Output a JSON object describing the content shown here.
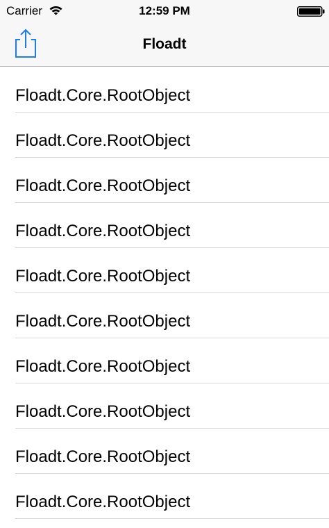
{
  "status_bar": {
    "carrier": "Carrier",
    "time": "12:59 PM",
    "wifi_icon": "wifi-icon",
    "battery_icon": "battery-full-icon"
  },
  "nav_bar": {
    "title": "Floadt",
    "share_icon": "share-icon",
    "accent_color": "#1a7cf9"
  },
  "list": {
    "items": [
      {
        "label": "Floadt.Core.RootObject"
      },
      {
        "label": "Floadt.Core.RootObject"
      },
      {
        "label": "Floadt.Core.RootObject"
      },
      {
        "label": "Floadt.Core.RootObject"
      },
      {
        "label": "Floadt.Core.RootObject"
      },
      {
        "label": "Floadt.Core.RootObject"
      },
      {
        "label": "Floadt.Core.RootObject"
      },
      {
        "label": "Floadt.Core.RootObject"
      },
      {
        "label": "Floadt.Core.RootObject"
      },
      {
        "label": "Floadt.Core.RootObject"
      }
    ]
  }
}
